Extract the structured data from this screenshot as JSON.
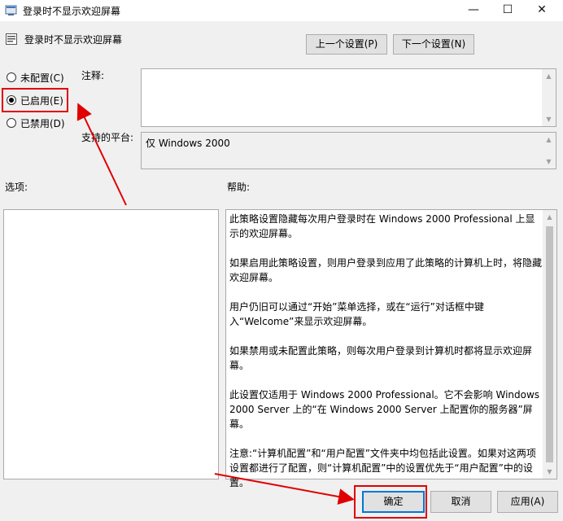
{
  "window": {
    "title": "登录时不显示欢迎屏幕",
    "controls": {
      "minimize": "—",
      "maximize": "☐",
      "close": "✕"
    }
  },
  "policy": {
    "name": "登录时不显示欢迎屏幕",
    "prev_button": "上一个设置(P)",
    "next_button": "下一个设置(N)"
  },
  "state": {
    "options": [
      {
        "label": "未配置(C)",
        "checked": false
      },
      {
        "label": "已启用(E)",
        "checked": true
      },
      {
        "label": "已禁用(D)",
        "checked": false
      }
    ]
  },
  "comment": {
    "label": "注释:",
    "value": ""
  },
  "platform": {
    "label": "支持的平台:",
    "value": "仅 Windows 2000"
  },
  "options_panel": {
    "label": "选项:"
  },
  "help": {
    "label": "帮助:",
    "paragraphs": [
      "此策略设置隐藏每次用户登录时在 Windows 2000 Professional 上显示的欢迎屏幕。",
      "如果启用此策略设置，则用户登录到应用了此策略的计算机上时，将隐藏欢迎屏幕。",
      "用户仍旧可以通过“开始”菜单选择，或在“运行”对话框中键入“Welcome”来显示欢迎屏幕。",
      "如果禁用或未配置此策略，则每次用户登录到计算机时都将显示欢迎屏幕。",
      "此设置仅适用于 Windows 2000 Professional。它不会影响 Windows 2000 Server 上的“在 Windows 2000 Server 上配置你的服务器”屏幕。",
      "注意:“计算机配置”和“用户配置”文件夹中均包括此设置。如果对这两项设置都进行了配置，则“计算机配置”中的设置优先于“用户配置”中的设置。"
    ]
  },
  "footer": {
    "ok": "确定",
    "cancel": "取消",
    "apply": "应用(A)"
  },
  "colors": {
    "annotation": "#e00000",
    "accent": "#0078d7"
  }
}
